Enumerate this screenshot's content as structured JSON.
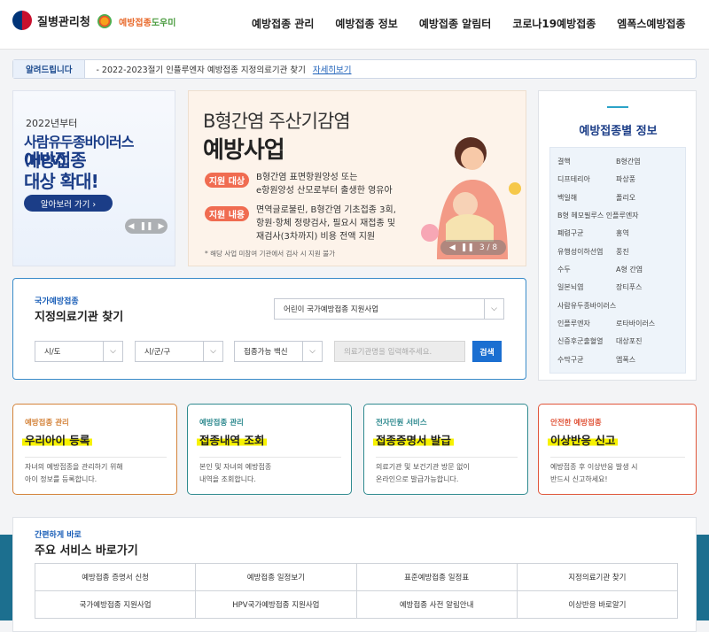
{
  "header": {
    "logo_text": "질병관리청",
    "logo2_a": "예방접종",
    "logo2_b": "도우미",
    "nav": [
      "예방접종 관리",
      "예방접종 정보",
      "예방접종 알림터",
      "코로나19예방접종",
      "엠폭스예방접종"
    ]
  },
  "notice": {
    "label": "알려드립니다",
    "text": "- 2022-2023절기 인플루엔자 예방접종 지정의료기관 찾기",
    "more": "자세히보기"
  },
  "banner_left": {
    "line1": "2022년부터",
    "line2": "사람유두종바이러스(HPV)",
    "line3": "예방접종",
    "line4": "대상 확대!",
    "button": "알아보러 가기 ›",
    "counter": "❚❚"
  },
  "banner_main": {
    "title1": "B형간염 주산기감염",
    "title2": "예방사업",
    "label1": "지원 대상",
    "desc1a": "B형간염 표면항원양성 또는",
    "desc1b": "e항원양성 산모로부터 출생한 영유아",
    "label2": "지원 내용",
    "desc2a": "면역글로불린, B형간염 기초접종 3회,",
    "desc2b": "항원·항체 정량검사, 필요시 재접종 및",
    "desc2c": "재검사(3차까지) 비용 전액 지원",
    "note": "* 해당 사업 미참여 기관에서 검사 시 지원 불가",
    "counter": "3 / 8"
  },
  "vaccine_info": {
    "title": "예방접종별 정보",
    "items": [
      "결핵",
      "B형간염",
      "디프테리아",
      "파상풍",
      "백일해",
      "폴리오",
      "B형 헤모필루스 인플루엔자",
      "",
      "폐렴구균",
      "홍역",
      "유행성이하선염",
      "풍진",
      "수두",
      "A형 간염",
      "일본뇌염",
      "장티푸스",
      "사람유두종바이러스",
      "",
      "인플루엔자",
      "로타바이러스",
      "신증후군출혈열",
      "대상포진",
      "수막구균",
      "엠폭스"
    ]
  },
  "finder": {
    "kicker": "국가예방접종",
    "title": "지정의료기관 찾기",
    "program": "어린이 국가예방접종 지원사업",
    "sido": "시/도",
    "sigungu": "시/군/구",
    "vaccine": "접종가능 백신",
    "input_placeholder": "의료기관명을 입력해주세요.",
    "search": "검색"
  },
  "services": [
    {
      "cat": "예방접종 관리",
      "name": "우리아이 등록",
      "d1": "자녀의 예방접종을 관리하기 위해",
      "d2": "아이 정보를 등록합니다.",
      "color": "#d4833a"
    },
    {
      "cat": "예방접종 관리",
      "name": "접종내역 조회",
      "d1": "본인 및 자녀의 예방접종",
      "d2": "내역을 조회합니다.",
      "color": "#2f8a8f"
    },
    {
      "cat": "전자민원 서비스",
      "name": "접종증명서 발급",
      "d1": "의료기관 및 보건기관 방문 없이",
      "d2": "온라인으로 발급가능합니다.",
      "color": "#2f8a8f"
    },
    {
      "cat": "안전한 예방접종",
      "name": "이상반응 신고",
      "d1": "예방접종 후 이상반응 발생 시",
      "d2": "반드시 신고하세요!",
      "color": "#e0553a"
    }
  ],
  "quick": {
    "kicker": "간편하게 바로",
    "title": "주요 서비스 바로가기",
    "links": [
      "예방접종 증명서 신청",
      "예방접종 일정보기",
      "표준예방접종 일정표",
      "지정의료기관 찾기",
      "국가예방접종 지원사업",
      "HPV국가예방접종 지원사업",
      "예방접종 사전 알림안내",
      "이상반응 바로알기"
    ]
  },
  "colors": {
    "primary": "#1b3d87",
    "accent_blue": "#1b6fd1",
    "highlight": "#f7f200"
  }
}
